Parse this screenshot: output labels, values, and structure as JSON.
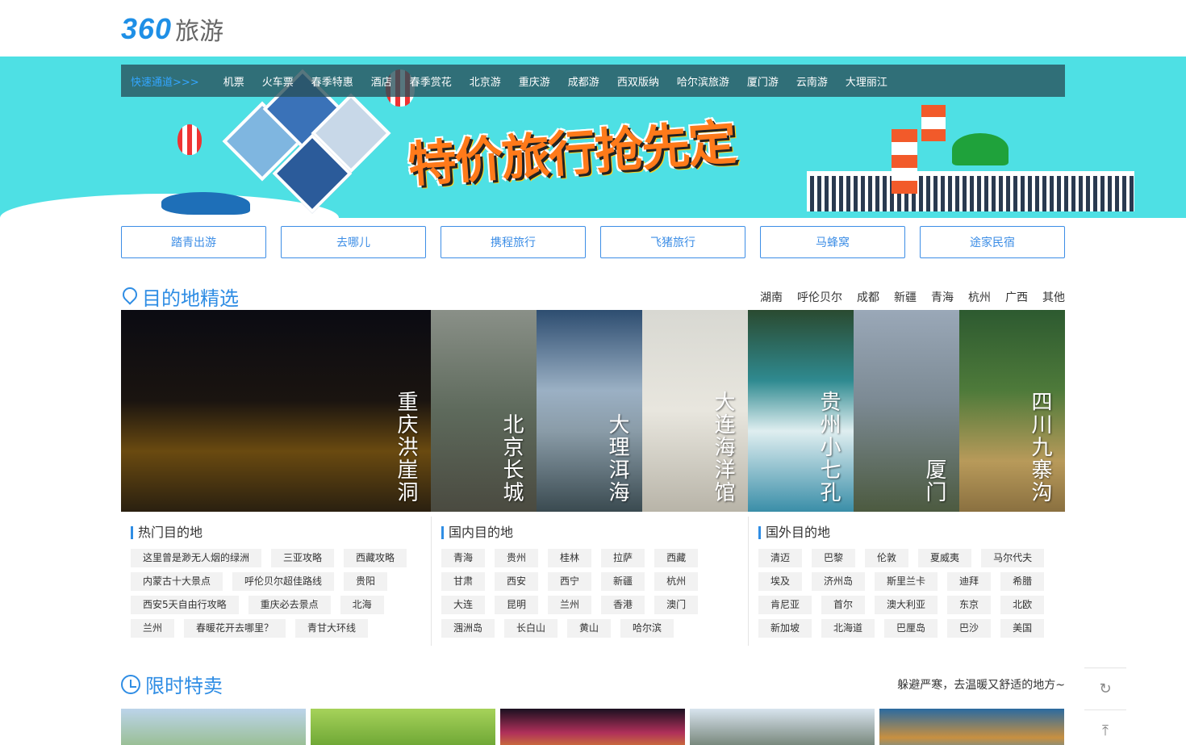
{
  "logo": {
    "num": "360",
    "text": "旅游"
  },
  "banner": {
    "quick_label": "快速通道>>>",
    "quick_items": [
      "机票",
      "火车票",
      "春季特惠",
      "酒店",
      "春季赏花",
      "北京游",
      "重庆游",
      "成都游",
      "西双版纳",
      "哈尔滨旅游",
      "厦门游",
      "云南游",
      "大理丽江"
    ],
    "slogan": "特价旅行抢先定"
  },
  "partners": [
    "踏青出游",
    "去哪儿",
    "携程旅行",
    "飞猪旅行",
    "马蜂窝",
    "途家民宿"
  ],
  "destinations": {
    "title": "目的地精选",
    "regions": [
      "湖南",
      "呼伦贝尔",
      "成都",
      "新疆",
      "青海",
      "杭州",
      "广西",
      "其他"
    ],
    "tiles": [
      "重庆洪崖洞",
      "北京长城",
      "大理洱海",
      "大连海洋馆",
      "贵州小七孔",
      "厦门",
      "四川九寨沟"
    ]
  },
  "lists": {
    "hot": {
      "title": "热门目的地",
      "tags": [
        "这里曾是渺无人烟的绿洲",
        "三亚攻略",
        "西藏攻略",
        "内蒙古十大景点",
        "呼伦贝尔超佳路线",
        "贵阳",
        "西安5天自由行攻略",
        "重庆必去景点",
        "北海",
        "兰州",
        "春暖花开去哪里？",
        "青甘大环线"
      ]
    },
    "domestic": {
      "title": "国内目的地",
      "tags": [
        "青海",
        "贵州",
        "桂林",
        "拉萨",
        "西藏",
        "甘肃",
        "西安",
        "西宁",
        "新疆",
        "杭州",
        "大连",
        "昆明",
        "兰州",
        "香港",
        "澳门",
        "涠洲岛",
        "长白山",
        "黄山",
        "哈尔滨"
      ]
    },
    "abroad": {
      "title": "国外目的地",
      "tags": [
        "清迈",
        "巴黎",
        "伦敦",
        "夏威夷",
        "马尔代夫",
        "埃及",
        "济州岛",
        "斯里兰卡",
        "迪拜",
        "希腊",
        "肯尼亚",
        "首尔",
        "澳大利亚",
        "东京",
        "北欧",
        "新加坡",
        "北海道",
        "巴厘岛",
        "巴沙",
        "美国"
      ]
    }
  },
  "flash_sale": {
    "title": "限时特卖",
    "subtitle": "躲避严寒，去温暖又舒适的地方~"
  },
  "side": {
    "refresh": "↻",
    "top": "⤒"
  }
}
